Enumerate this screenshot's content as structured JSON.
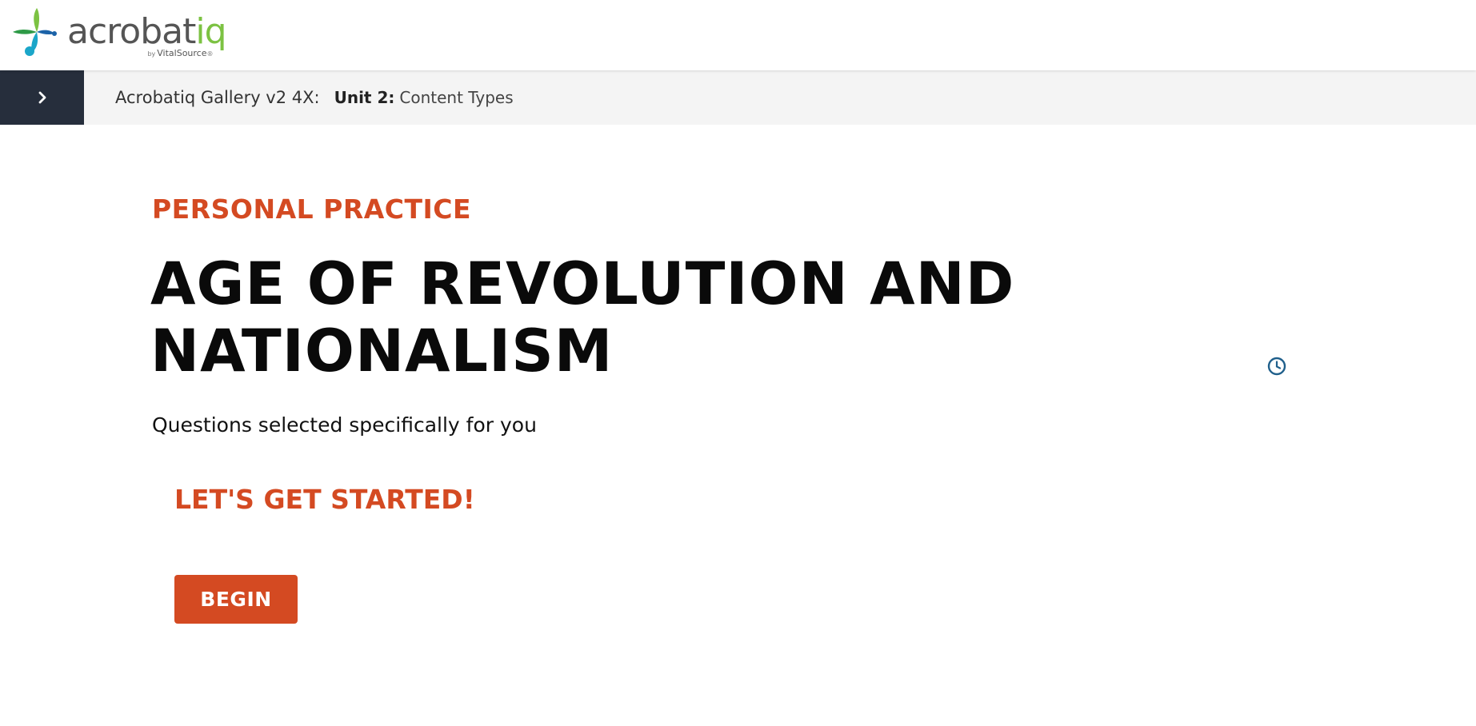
{
  "header": {
    "logo_word_main": "acrobat",
    "logo_word_accent": "iq",
    "logo_by": "by",
    "logo_brand": "VitalSource",
    "logo_brand_mark": "®",
    "brand_colors": {
      "green": "#7cc242",
      "blue": "#1c63a8",
      "teal": "#1ba6c9",
      "dark_green": "#2e9a47"
    }
  },
  "breadcrumb": {
    "toggle_icon": "chevron-right-icon",
    "course": "Acrobatiq Gallery v2 4X:",
    "unit_label": "Unit 2:",
    "unit_topic": "Content Types"
  },
  "main": {
    "eyebrow": "PERSONAL PRACTICE",
    "title": "AGE OF REVOLUTION AND NATIONALISM",
    "subtitle": "Questions selected specifically for you",
    "clock_icon": "clock-icon",
    "started_heading": "LET'S GET STARTED!",
    "begin_label": "BEGIN"
  },
  "colors": {
    "accent": "#d44a22",
    "nav_dark": "#262e3c",
    "breadcrumb_bg": "#f4f4f4",
    "clock": "#1f5f8b"
  }
}
